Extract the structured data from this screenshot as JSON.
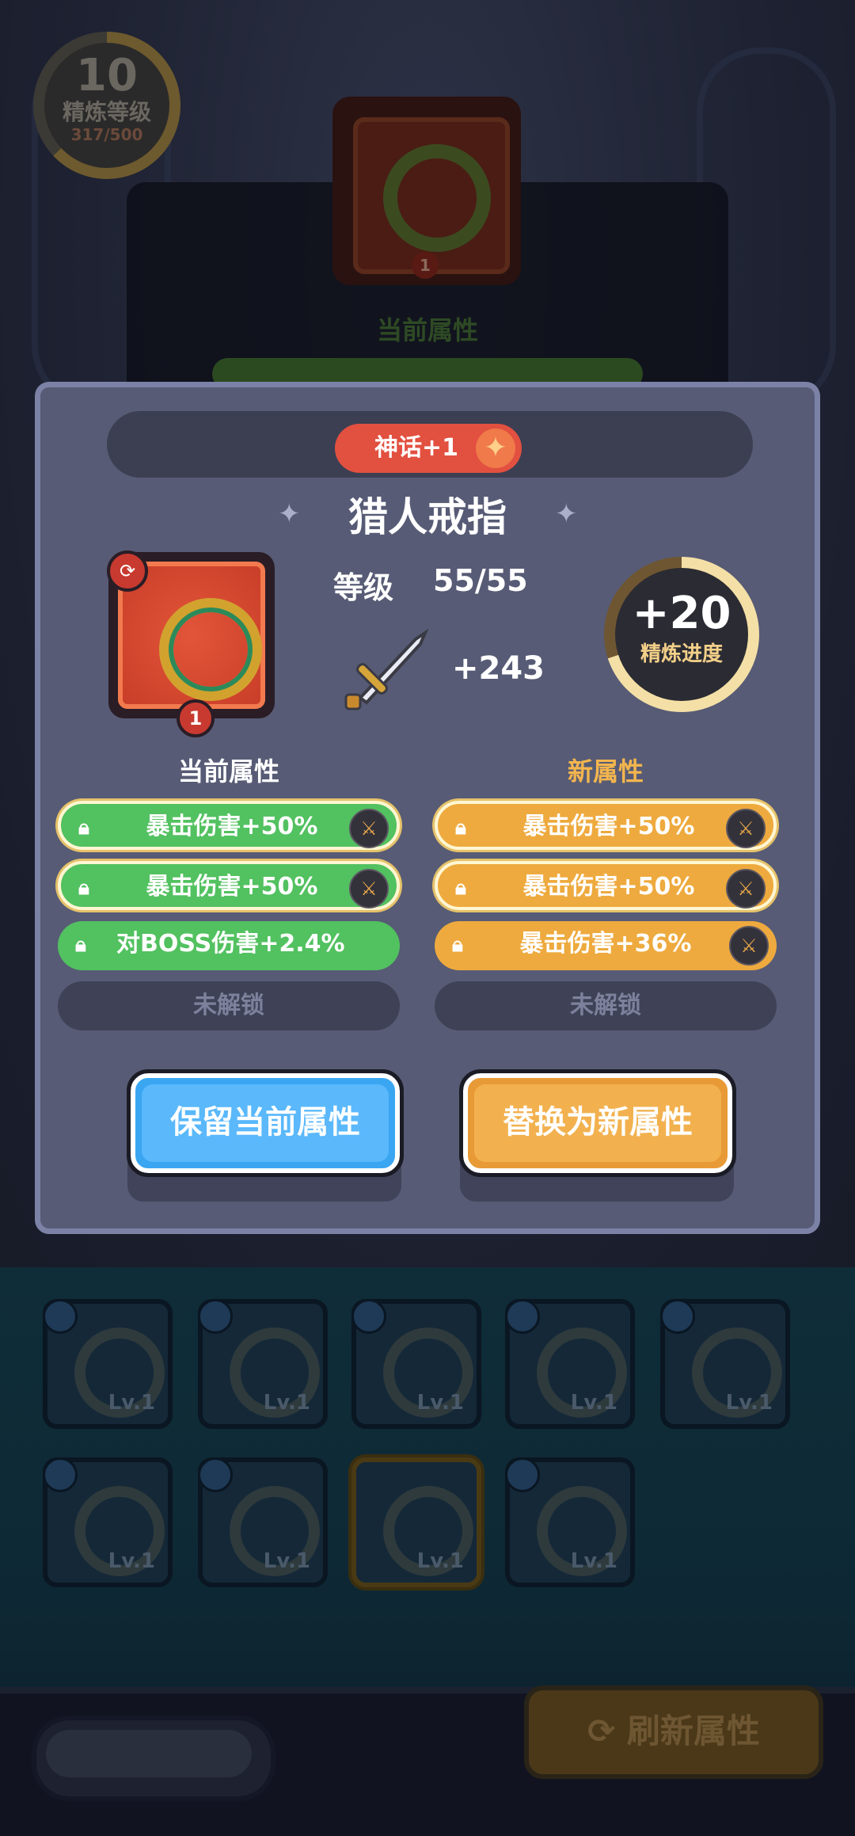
{
  "background": {
    "refine_level": "10",
    "refine_level_label": "精炼等级",
    "refine_progress": "317/500",
    "item_badge": "1",
    "current_attr_title": "当前属性",
    "inventory": [
      {
        "label": "Lv.1"
      },
      {
        "label": "Lv.1"
      },
      {
        "label": "Lv.1"
      },
      {
        "label": "Lv.1"
      },
      {
        "label": "Lv.1"
      },
      {
        "label": "Lv.1"
      },
      {
        "label": "Lv.1"
      },
      {
        "label": "Lv.1"
      },
      {
        "label": "Lv.1"
      }
    ],
    "refresh_button": "刷新属性"
  },
  "modal": {
    "rarity_tag": "神话+1",
    "item_name": "猎人戒指",
    "item_badge": "1",
    "level_label": "等级",
    "level_value": "55/55",
    "power_value": "+243",
    "refine_gain": "+20",
    "refine_gain_label": "精炼进度",
    "current_title": "当前属性",
    "new_title": "新属性",
    "current_attrs": [
      {
        "text": "暴击伤害+50%",
        "locked_slot": false
      },
      {
        "text": "暴击伤害+50%",
        "locked_slot": false
      },
      {
        "text": "对BOSS伤害+2.4%",
        "locked_slot": false
      },
      {
        "text": "未解锁",
        "locked_slot": true
      }
    ],
    "new_attrs": [
      {
        "text": "暴击伤害+50%",
        "locked_slot": false
      },
      {
        "text": "暴击伤害+50%",
        "locked_slot": false
      },
      {
        "text": "暴击伤害+36%",
        "locked_slot": false
      },
      {
        "text": "未解锁",
        "locked_slot": true
      }
    ],
    "keep_button": "保留当前属性",
    "replace_button": "替换为新属性"
  },
  "colors": {
    "modal_bg": "#575b75",
    "current_attr": "#52c160",
    "new_attr": "#eeaa3e",
    "rarity": "#e25040",
    "keep_button": "#5ab8fb",
    "replace_button": "#f2b14e"
  }
}
